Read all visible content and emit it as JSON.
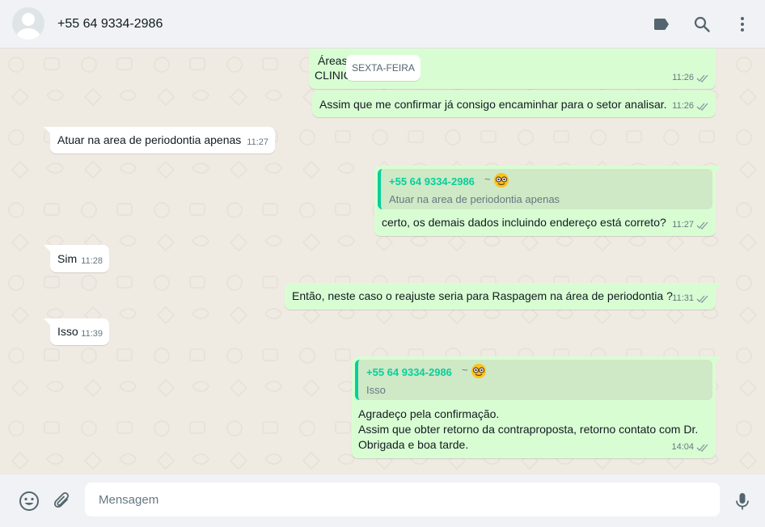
{
  "header": {
    "contact_name": "+55 64 9334-2986",
    "icons": [
      "label-icon",
      "search-icon",
      "menu-icon"
    ]
  },
  "date_chip": "SEXTA-FEIRA",
  "messages": [
    {
      "direction": "out",
      "text_line1": "Áreas",
      "text_line2": "CLINIC",
      "time": "11:26",
      "status": "read"
    },
    {
      "direction": "out",
      "text": "Assim que me confirmar já consigo encaminhar para o setor analisar.",
      "time": "11:26",
      "status": "read"
    },
    {
      "direction": "in",
      "text": "Atuar na area de periodontia apenas",
      "time": "11:27"
    },
    {
      "direction": "out",
      "quote": {
        "author": "+55 64 9334-2986",
        "author_suffix": "~",
        "text": "Atuar na area de periodontia apenas"
      },
      "text": "certo, os demais dados incluindo endereço está correto?",
      "time": "11:27",
      "status": "read"
    },
    {
      "direction": "in",
      "text": "Sim",
      "time": "11:28"
    },
    {
      "direction": "out",
      "text": "Então, neste caso o reajuste seria para Raspagem na área de periodontia ?",
      "time": "11:31",
      "status": "read"
    },
    {
      "direction": "in",
      "text": "Isso",
      "time": "11:39"
    },
    {
      "direction": "out",
      "quote": {
        "author": "+55 64 9334-2986",
        "author_suffix": "~",
        "text": "Isso"
      },
      "lines": [
        "Agradeço pela confirmação.",
        "Assim que obter retorno da contraproposta, retorno contato com Dr.",
        "Obrigada e boa tarde."
      ],
      "time": "14:04",
      "status": "read"
    }
  ],
  "footer": {
    "placeholder": "Mensagem",
    "icons": [
      "emoji-icon",
      "attach-icon",
      "mic-icon"
    ]
  },
  "colors": {
    "outgoing_bubble": "#d9fdd3",
    "incoming_bubble": "#ffffff",
    "quote_accent": "#06cf9c",
    "read_ticks": "#53bdeb",
    "header_bg": "#f0f2f5",
    "chat_bg": "#efeae2"
  }
}
